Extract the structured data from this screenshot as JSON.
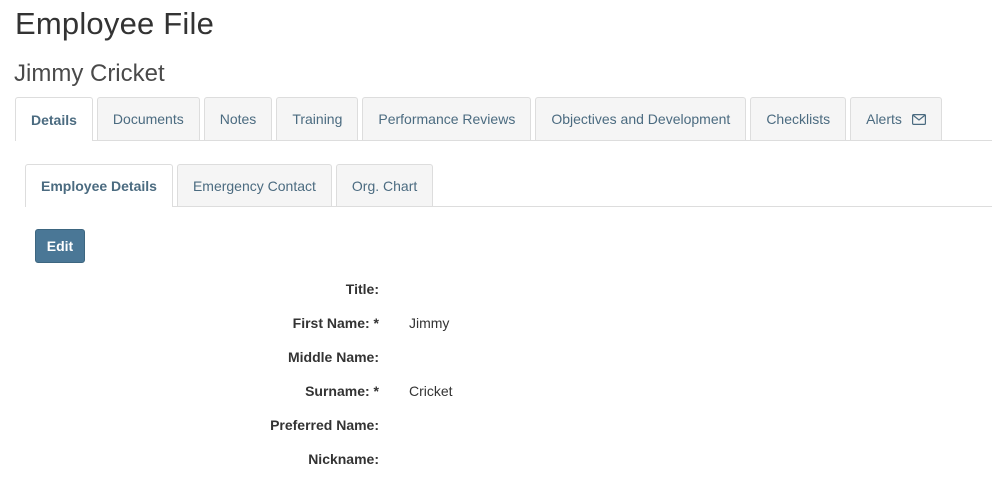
{
  "page": {
    "title": "Employee File",
    "employee_name": "Jimmy Cricket"
  },
  "main_tabs": [
    {
      "label": "Details",
      "active": true
    },
    {
      "label": "Documents",
      "active": false
    },
    {
      "label": "Notes",
      "active": false
    },
    {
      "label": "Training",
      "active": false
    },
    {
      "label": "Performance Reviews",
      "active": false
    },
    {
      "label": "Objectives and Development",
      "active": false
    },
    {
      "label": "Checklists",
      "active": false
    },
    {
      "label": "Alerts",
      "active": false,
      "icon": "envelope-icon"
    }
  ],
  "sub_tabs": [
    {
      "label": "Employee Details",
      "active": true
    },
    {
      "label": "Emergency Contact",
      "active": false
    },
    {
      "label": "Org. Chart",
      "active": false
    }
  ],
  "actions": {
    "edit_label": "Edit"
  },
  "fields": [
    {
      "label": "Title:",
      "value": ""
    },
    {
      "label": "First Name: *",
      "value": "Jimmy"
    },
    {
      "label": "Middle Name:",
      "value": ""
    },
    {
      "label": "Surname: *",
      "value": "Cricket"
    },
    {
      "label": "Preferred Name:",
      "value": ""
    },
    {
      "label": "Nickname:",
      "value": ""
    }
  ],
  "colors": {
    "tab_text": "#4b6b80",
    "button_bg": "#4a7796"
  }
}
